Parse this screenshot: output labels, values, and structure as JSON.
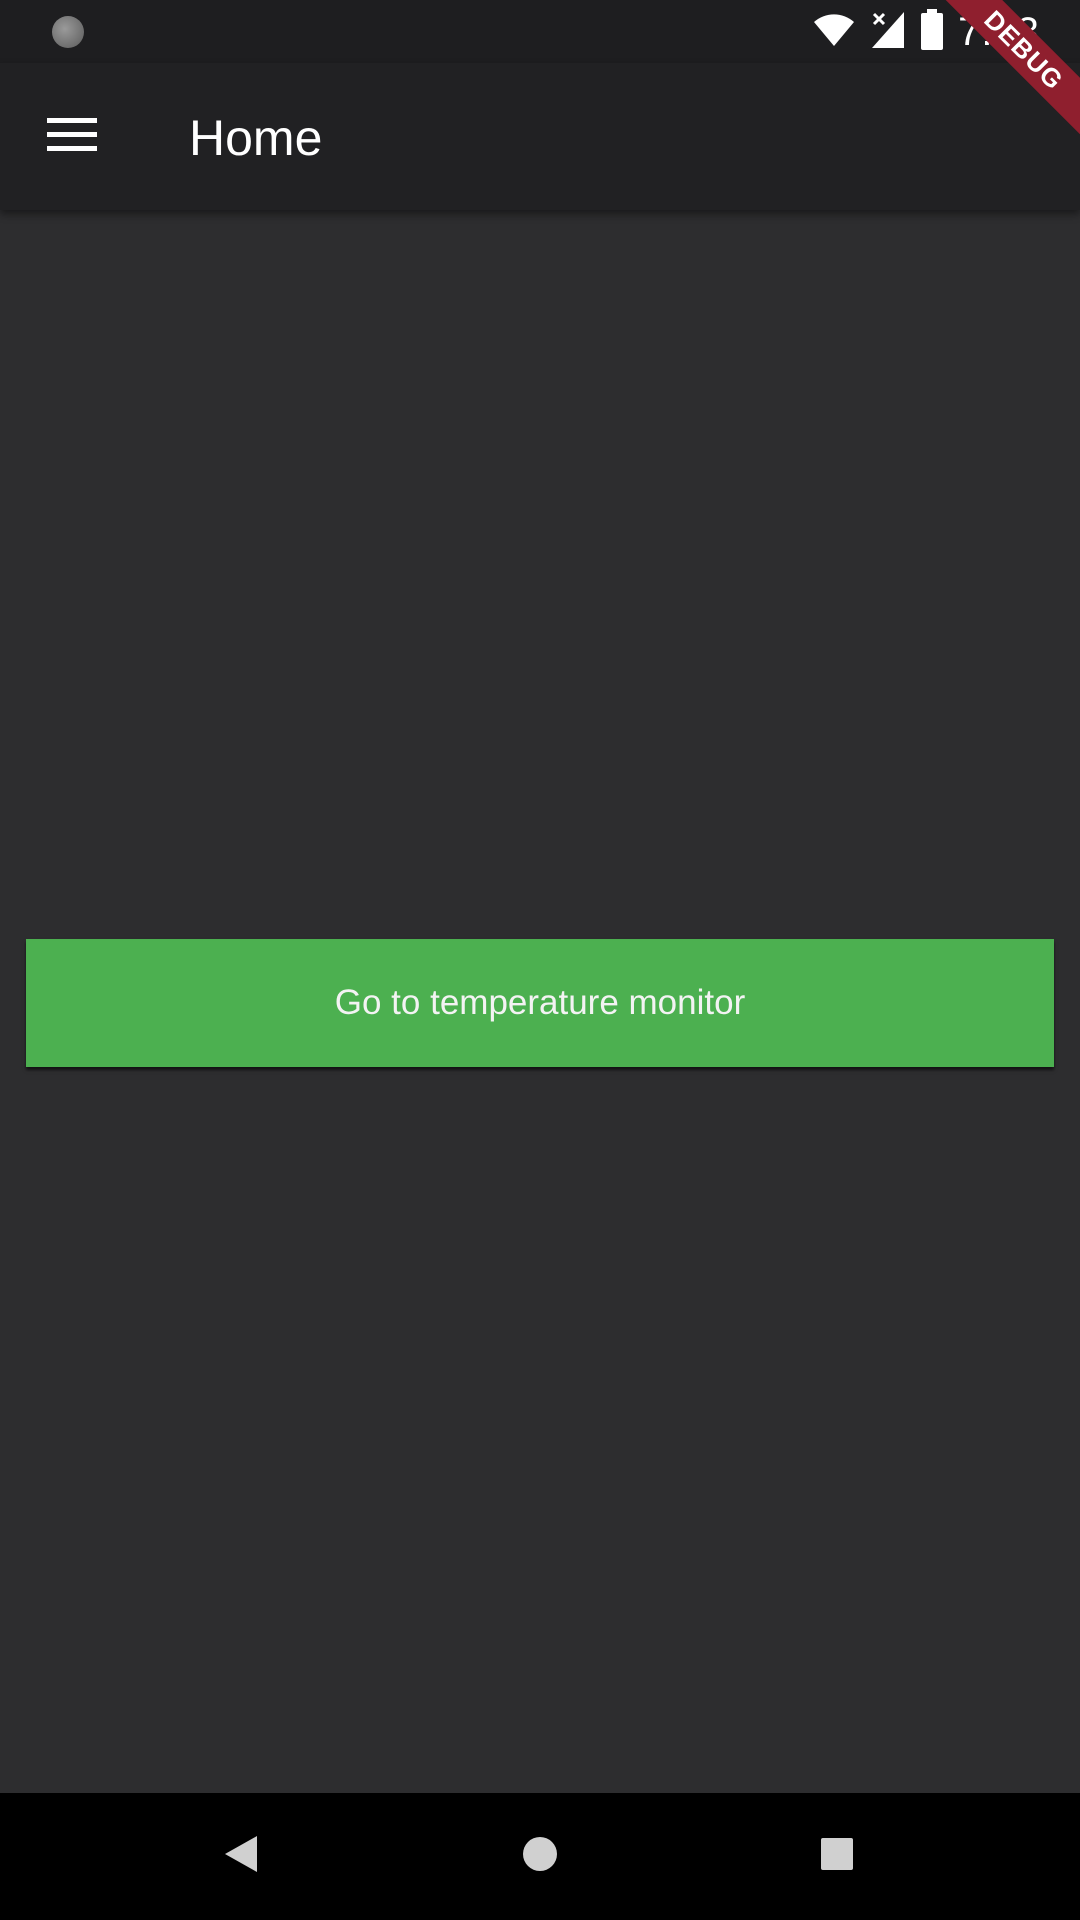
{
  "status_bar": {
    "time": "7:03",
    "icons": [
      "notification-dot-icon",
      "wifi-icon",
      "signal-icon",
      "battery-icon"
    ]
  },
  "debug_banner": {
    "label": "DEBUG",
    "color": "#8f1f2e"
  },
  "app_bar": {
    "title": "Home",
    "menu_icon": "menu-icon"
  },
  "main": {
    "primary_button_label": "Go to temperature monitor",
    "primary_button_color": "#4cb050"
  },
  "nav_bar": {
    "buttons": [
      "back-icon",
      "home-icon",
      "recents-icon"
    ]
  },
  "colors": {
    "background": "#2d2d2f",
    "app_bar": "#212123",
    "accent": "#4cb050"
  }
}
